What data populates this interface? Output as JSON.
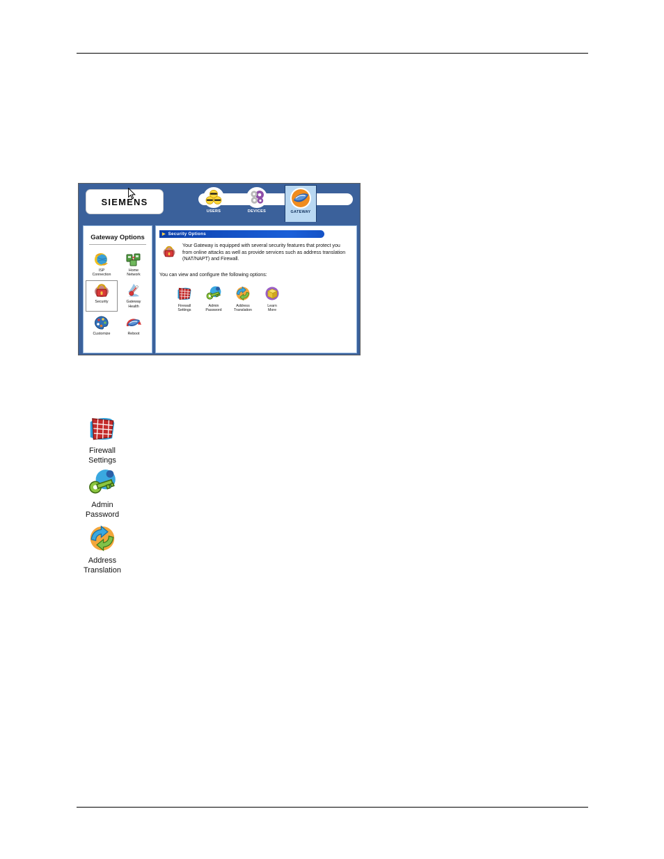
{
  "page": {
    "rules": {
      "top_label": "header-rule",
      "bottom_label": "footer-rule"
    }
  },
  "widget": {
    "brand": {
      "logo_text": "SIEMENS",
      "logo_icon": "siemens-wordmark"
    },
    "cursor_icon": "mouse-pointer-icon",
    "tabs": [
      {
        "id": "users",
        "label": "USERS",
        "icon": "users-faces-icon",
        "selected": false
      },
      {
        "id": "devices",
        "label": "DEVICES",
        "icon": "gears-devices-icon",
        "selected": false
      },
      {
        "id": "gateway",
        "label": "GATEWAY",
        "icon": "gateway-router-icon",
        "selected": true
      }
    ],
    "sidebar": {
      "title": "Gateway Options",
      "items": [
        {
          "id": "isp-connection",
          "label": "ISP\nConnection",
          "icon": "globe-arrows-icon",
          "selected": false
        },
        {
          "id": "home-network",
          "label": "Home\nNetwork",
          "icon": "home-network-icon",
          "selected": false
        },
        {
          "id": "security",
          "label": "Security",
          "icon": "padlock-icon",
          "selected": true
        },
        {
          "id": "gateway-health",
          "label": "Gateway\nHealth",
          "icon": "thermometer-icon",
          "selected": false
        },
        {
          "id": "customize",
          "label": "Customize",
          "icon": "palette-icon",
          "selected": false
        },
        {
          "id": "reboot",
          "label": "Reboot",
          "icon": "reboot-gateway-icon",
          "selected": false
        }
      ]
    },
    "content": {
      "header_mark": "▶",
      "header_title": "Security Options",
      "intro_icon": "padlock-icon",
      "intro_paragraph": "Your Gateway is equipped with several security features that protect you from online attacks as well as provide services such as address translation (NAT/NAPT) and Firewall.",
      "sub_paragraph": "You can view and configure the following options:",
      "options": [
        {
          "id": "firewall-settings",
          "label": "Firewall\nSettings",
          "icon": "firewall-brick-icon"
        },
        {
          "id": "admin-password",
          "label": "Admin\nPassword",
          "icon": "key-icon"
        },
        {
          "id": "address-translation",
          "label": "Address\nTranslation",
          "icon": "recycle-arrows-icon"
        },
        {
          "id": "learn-more",
          "label": "Learn\nMore",
          "icon": "yellow-box-icon"
        }
      ]
    }
  },
  "callouts": [
    {
      "id": "firewall-settings",
      "label": "Firewall\nSettings",
      "icon": "firewall-brick-icon"
    },
    {
      "id": "admin-password",
      "label": "Admin\nPassword",
      "icon": "key-icon"
    },
    {
      "id": "address-translation",
      "label": "Address\nTranslation",
      "icon": "recycle-arrows-icon"
    }
  ],
  "colors": {
    "header_blue": "#3b619b",
    "panel_border": "#8fb4dd",
    "content_header_blue": "#1452c6",
    "selected_tab_bg": "#b9d8f2",
    "firewall_red": "#c42b2b",
    "key_green": "#8cc63f",
    "arrows_orange": "#f3a63b",
    "learn_more_yellow": "#f2c94c"
  }
}
